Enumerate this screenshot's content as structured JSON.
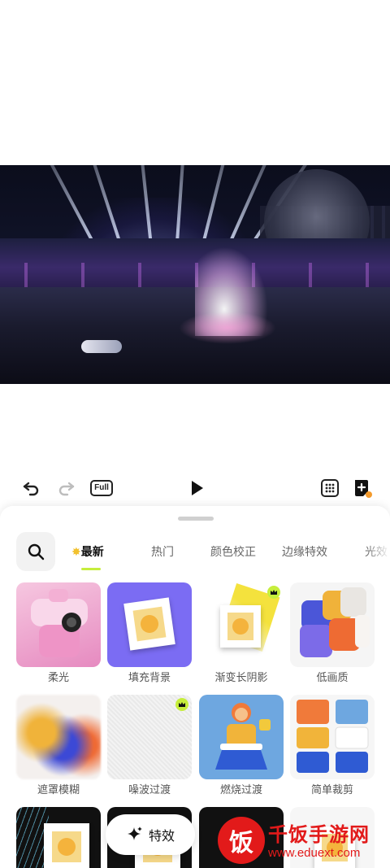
{
  "toolbar": {
    "undo_icon": "undo-icon",
    "redo_icon": "redo-icon",
    "full_label": "Full",
    "play_icon": "play-icon",
    "grid_icon": "grid-icon",
    "add_icon": "add-note-icon"
  },
  "tabs": {
    "items": [
      {
        "label": "最新",
        "active": true,
        "badge_icon": "star-icon"
      },
      {
        "label": "热门",
        "active": false
      },
      {
        "label": "颜色校正",
        "active": false
      },
      {
        "label": "边缘特效",
        "active": false
      },
      {
        "label": "光效",
        "active": false
      }
    ],
    "accent": "#c6ee3c"
  },
  "effects": [
    {
      "label": "柔光",
      "premium": false
    },
    {
      "label": "填充背景",
      "premium": false
    },
    {
      "label": "渐变长阴影",
      "premium": true
    },
    {
      "label": "低画质",
      "premium": false
    },
    {
      "label": "遮罩模糊",
      "premium": false
    },
    {
      "label": "噪波过渡",
      "premium": true
    },
    {
      "label": "燃烧过渡",
      "premium": false
    },
    {
      "label": "简单裁剪",
      "premium": false
    }
  ],
  "floating": {
    "label": "特效",
    "icon": "sparkle-icon"
  },
  "watermark": {
    "logo_char": "饭",
    "title": "千饭手游网",
    "url": "www.eduext.com"
  }
}
